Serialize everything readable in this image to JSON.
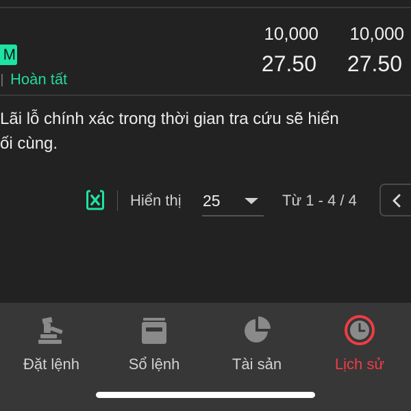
{
  "order": {
    "side_badge": "M",
    "status": "Hoàn tất",
    "col1": {
      "qty": "10,000",
      "price": "27.50"
    },
    "col2": {
      "qty": "10,000",
      "price": "27.50"
    }
  },
  "note": {
    "line1": "Lãi lỗ chính xác trong thời gian tra cứu sẽ hiển",
    "line2": "ối cùng."
  },
  "pagination": {
    "show_label": "Hiển thị",
    "page_size": "25",
    "range": "Từ 1 - 4 / 4"
  },
  "nav": {
    "items": [
      {
        "label": "Đặt lệnh",
        "icon": "gavel-icon"
      },
      {
        "label": "Sổ lệnh",
        "icon": "order-book-icon"
      },
      {
        "label": "Tài sản",
        "icon": "pie-chart-icon"
      },
      {
        "label": "Lịch sử",
        "icon": "clock-icon"
      }
    ],
    "active_index": 3,
    "active_color": "#f23c44"
  },
  "colors": {
    "background": "#222222",
    "accent_green": "#22d9a0",
    "nav_background": "#373737"
  }
}
